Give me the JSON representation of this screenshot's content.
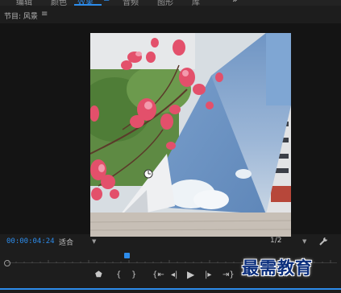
{
  "workspace_tabs": [
    {
      "label": "编辑",
      "active": false
    },
    {
      "label": "颜色",
      "active": false
    },
    {
      "label": "效果",
      "active": true
    },
    {
      "label": "音频",
      "active": false
    },
    {
      "label": "图形",
      "active": false
    },
    {
      "label": "库",
      "active": false
    }
  ],
  "panel": {
    "title": "节目: 风景",
    "menu_icon": "hamburger-menu-icon"
  },
  "controls": {
    "timecode": "00:00:04:24",
    "fit_label": "适合",
    "resolution_label": "1/2"
  },
  "playback": {
    "playhead_position_fraction": 0.36
  },
  "watermark": "最需教育",
  "accent_color": "#2d8ceb",
  "icons": [
    "more-panels-icon",
    "marker-icon",
    "in-point-icon",
    "out-point-icon",
    "go-to-in-icon",
    "step-back-icon",
    "play-icon",
    "step-forward-icon",
    "go-to-out-icon",
    "settings-wrench-icon"
  ]
}
